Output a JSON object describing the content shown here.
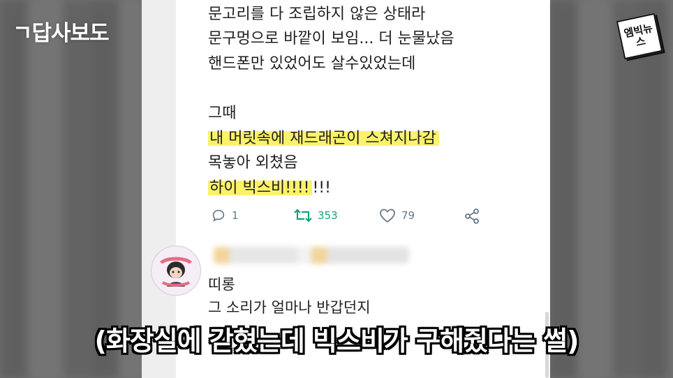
{
  "overlay": {
    "channel_title": "ㄱ답사보도",
    "logo_text": "엠빅뉴스",
    "caption": "(화장실에 갇혔는데 빅스비가 구해줬다는 썰)"
  },
  "tweet": {
    "lines": [
      "문고리를 다 조립하지 않은 상태라",
      "문구멍으로 바깥이 보임... 더 눈물났음",
      "핸드폰만 있었어도 살수있었는데",
      "그때",
      "내 머릿속에 재드래곤이 스쳐지나감",
      "목놓아 외쳤음",
      "하이 빅스비!!!!!!!"
    ],
    "highlight_line_5": "내 머릿속에 재드래곤이 스쳐지나감",
    "highlight_line_7_part": "하이 빅스비!!!!",
    "line_7_rest": "!!!",
    "actions": {
      "reply_count": "1",
      "retweet_count": "353",
      "like_count": "79"
    },
    "colors": {
      "highlight": "#fbf26a",
      "retweet": "#17a27a",
      "icon_gray": "#657786"
    }
  },
  "reply": {
    "lines": [
      "띠롱",
      "그 소리가 얼마나 반갑던지"
    ]
  }
}
